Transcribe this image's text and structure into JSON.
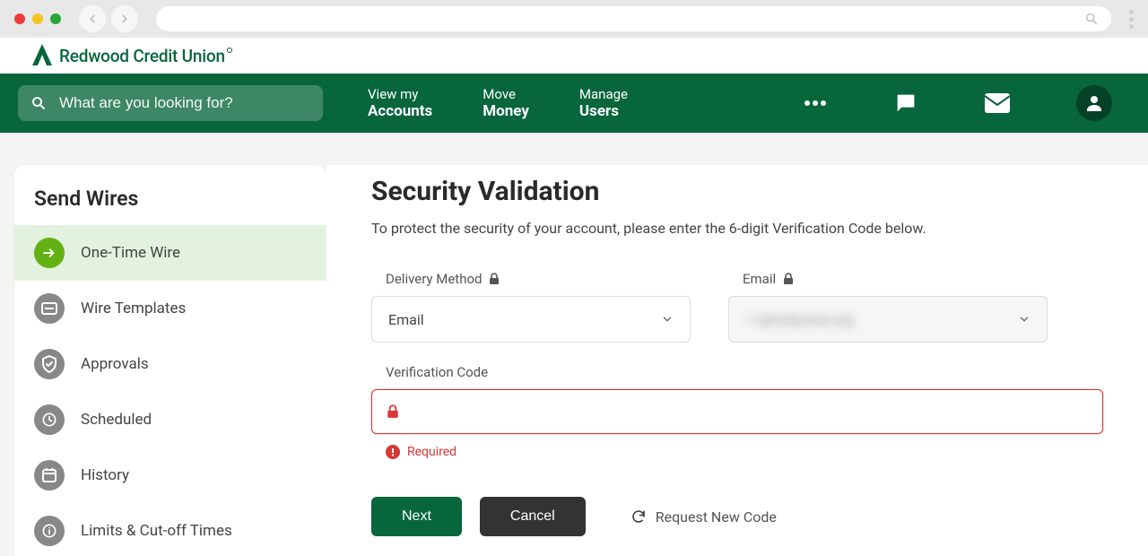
{
  "brand": {
    "name": "Redwood Credit Union"
  },
  "search": {
    "placeholder": "What are you looking for?"
  },
  "nav": {
    "items": [
      {
        "line1": "View my",
        "line2": "Accounts"
      },
      {
        "line1": "Move",
        "line2": "Money"
      },
      {
        "line1": "Manage",
        "line2": "Users"
      }
    ]
  },
  "sidebar": {
    "title": "Send Wires",
    "items": [
      {
        "label": "One-Time Wire"
      },
      {
        "label": "Wire Templates"
      },
      {
        "label": "Approvals"
      },
      {
        "label": "Scheduled"
      },
      {
        "label": "History"
      },
      {
        "label": "Limits & Cut-off Times"
      }
    ]
  },
  "main": {
    "title": "Security Validation",
    "subtitle": "To protect the security of your account, please enter the 6-digit Verification Code below.",
    "delivery_label": "Delivery Method",
    "delivery_value": "Email",
    "email_label": "Email",
    "email_value": "•••@redacted.org",
    "code_label": "Verification Code",
    "code_error": "Required",
    "next": "Next",
    "cancel": "Cancel",
    "request": "Request New Code"
  }
}
